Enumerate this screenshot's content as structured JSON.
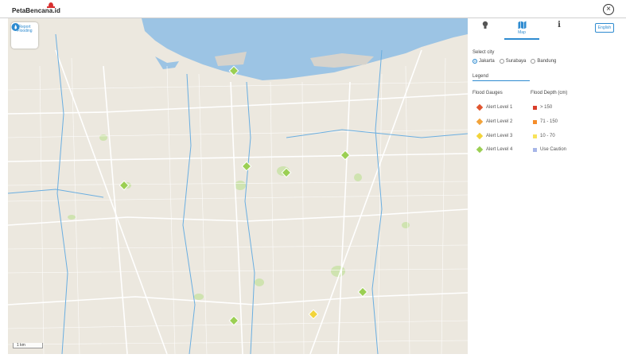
{
  "header": {
    "logo_text": "PetaBencana.id",
    "close_icon": "close-icon"
  },
  "map": {
    "report_button_label": "Report Flooding",
    "report_icon": "water-drop-icon",
    "scale_label": "1 km",
    "colors": {
      "water": "#9cc4e4",
      "land": "#ece8df",
      "park": "#cfe3b0",
      "road": "#ffffff",
      "river": "#6aaee0"
    }
  },
  "panel": {
    "tabs": [
      {
        "icon": "lamp-icon",
        "label": ""
      },
      {
        "icon": "map-icon",
        "label": "Map"
      },
      {
        "icon": "info-icon",
        "label": ""
      }
    ],
    "language_button": "English",
    "select_city_label": "Select city",
    "cities": [
      {
        "label": "Jakarta",
        "selected": true
      },
      {
        "label": "Surabaya",
        "selected": false
      },
      {
        "label": "Bandung",
        "selected": false
      }
    ],
    "legend_title": "Legend",
    "flood_gauges_header": "Flood Gauges",
    "flood_depth_header": "Flood Depth (cm)",
    "gauges": [
      {
        "label": "Alert Level 1",
        "color": "#e0552f",
        "icon": "alert-level-1-icon"
      },
      {
        "label": "Alert Level 2",
        "color": "#f2a33a",
        "icon": "alert-level-2-icon"
      },
      {
        "label": "Alert Level 3",
        "color": "#f2d43a",
        "icon": "alert-level-3-icon"
      },
      {
        "label": "Alert Level 4",
        "color": "#9bcf53",
        "icon": "alert-level-4-icon"
      }
    ],
    "depths": [
      {
        "label": "> 150",
        "color": "#d93d2b"
      },
      {
        "label": "71 - 150",
        "color": "#f58d2a"
      },
      {
        "label": "10 - 70",
        "color": "#f7e35b"
      },
      {
        "label": "Use Caution",
        "color": "#a7b6e8"
      }
    ]
  }
}
